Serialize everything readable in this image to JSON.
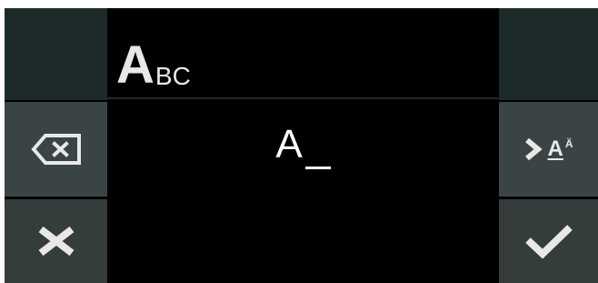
{
  "mode": {
    "big": "A",
    "small": "BC"
  },
  "input": {
    "value": "A"
  },
  "buttons": {
    "backspace_icon": "backspace-icon",
    "clear_icon": "close-icon",
    "next_mode": {
      "main": "A",
      "sup": "Ä"
    },
    "confirm_icon": "checkmark-icon"
  },
  "colors": {
    "button_bg": "#3b4444",
    "corner_bg": "#1c2a2a",
    "icon": "#e8e8e8",
    "text": "#ffffff"
  }
}
